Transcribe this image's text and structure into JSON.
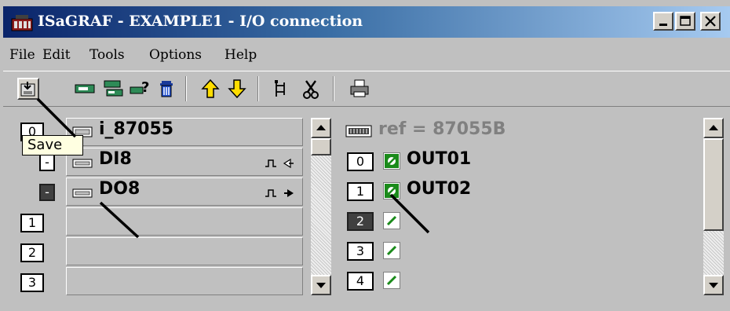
{
  "window": {
    "title": "ISaGRAF - EXAMPLE1 - I/O connection",
    "controls": [
      "minimize",
      "maximize",
      "close"
    ]
  },
  "menu": {
    "items": [
      "File",
      "Edit",
      "Tools",
      "Options",
      "Help"
    ]
  },
  "toolbar": {
    "buttons": [
      "save-icon",
      "board-icon",
      "board-list-icon",
      "board-help-icon",
      "delete-icon",
      "arrow-up-icon",
      "arrow-down-icon",
      "tree-icon",
      "cut-icon",
      "print-icon"
    ]
  },
  "tooltip": {
    "text": "Save"
  },
  "left_panel": {
    "board": {
      "slot": "0",
      "name": "i_87055"
    },
    "rows": [
      {
        "slot": "-",
        "name": "DI8",
        "dir_icon": "input-arrow-icon",
        "selected": false
      },
      {
        "slot": "-",
        "name": "DO8",
        "dir_icon": "output-arrow-icon",
        "selected": true
      },
      {
        "slot": "1",
        "name": ""
      },
      {
        "slot": "2",
        "name": ""
      },
      {
        "slot": "3",
        "name": ""
      }
    ]
  },
  "right_panel": {
    "ref": "ref = 87055B",
    "channels": [
      {
        "index": "0",
        "name": "OUT01",
        "connected": true
      },
      {
        "index": "1",
        "name": "OUT02",
        "connected": true
      },
      {
        "index": "2",
        "name": "",
        "connected": false,
        "selected": true
      },
      {
        "index": "3",
        "name": "",
        "connected": false
      },
      {
        "index": "4",
        "name": "",
        "connected": false
      }
    ]
  },
  "colors": {
    "titlebar_start": "#0a246a",
    "titlebar_end": "#a6caf0",
    "connected_icon": "#1a8a1a",
    "face": "#c0c0c0"
  }
}
